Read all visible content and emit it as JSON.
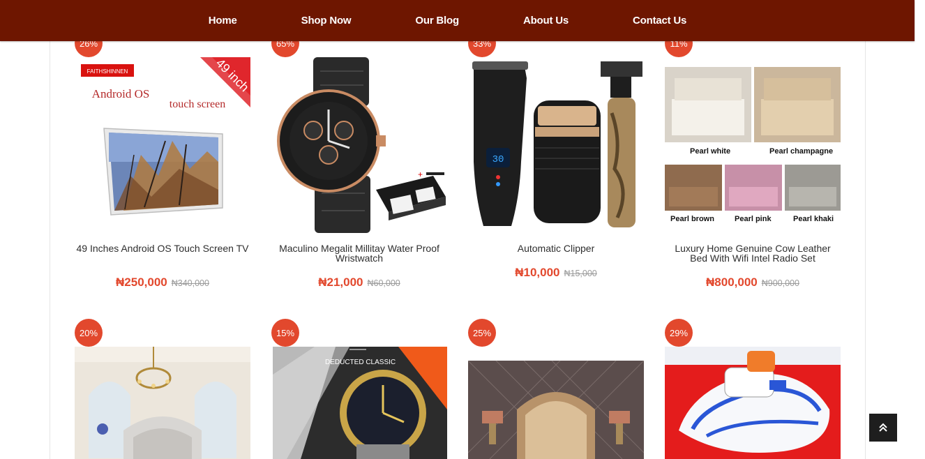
{
  "nav": {
    "items": [
      "Home",
      "Shop Now",
      "Our Blog",
      "About Us",
      "Contact Us"
    ]
  },
  "products": [
    {
      "badge": "26%",
      "title": "49 Inches Android OS Touch Screen TV",
      "price": "₦250,000",
      "old_price": "₦340,000",
      "image_text": {
        "brand_tag": "FAITHSHINNEN",
        "corner": "49 inch",
        "line1": "Android OS",
        "line2": "touch screen"
      }
    },
    {
      "badge": "65%",
      "title": "Maculino Megalit Millitay Water Proof Wristwatch",
      "price": "₦21,000",
      "old_price": "₦60,000"
    },
    {
      "badge": "33%",
      "title": "Automatic Clipper",
      "price": "₦10,000",
      "old_price": "₦15,000"
    },
    {
      "badge": "11%",
      "title": "Luxury Home Genuine Cow Leather Bed With Wifi Intel Radio Set",
      "price": "₦800,000",
      "old_price": "₦900,000",
      "image_text": {
        "labels": [
          "Pearl white",
          "Pearl champagne",
          "Pearl brown",
          "Pearl pink",
          "Pearl khaki"
        ]
      }
    },
    {
      "badge": "20%"
    },
    {
      "badge": "15%",
      "image_text": {
        "caption": "DEDUCTED CLASSIC"
      }
    },
    {
      "badge": "25%"
    },
    {
      "badge": "29%"
    }
  ],
  "colors": {
    "nav_bg": "#6e1600",
    "accent": "#e2482d"
  },
  "icons": {
    "back_to_top": "double-chevron-up-icon"
  }
}
